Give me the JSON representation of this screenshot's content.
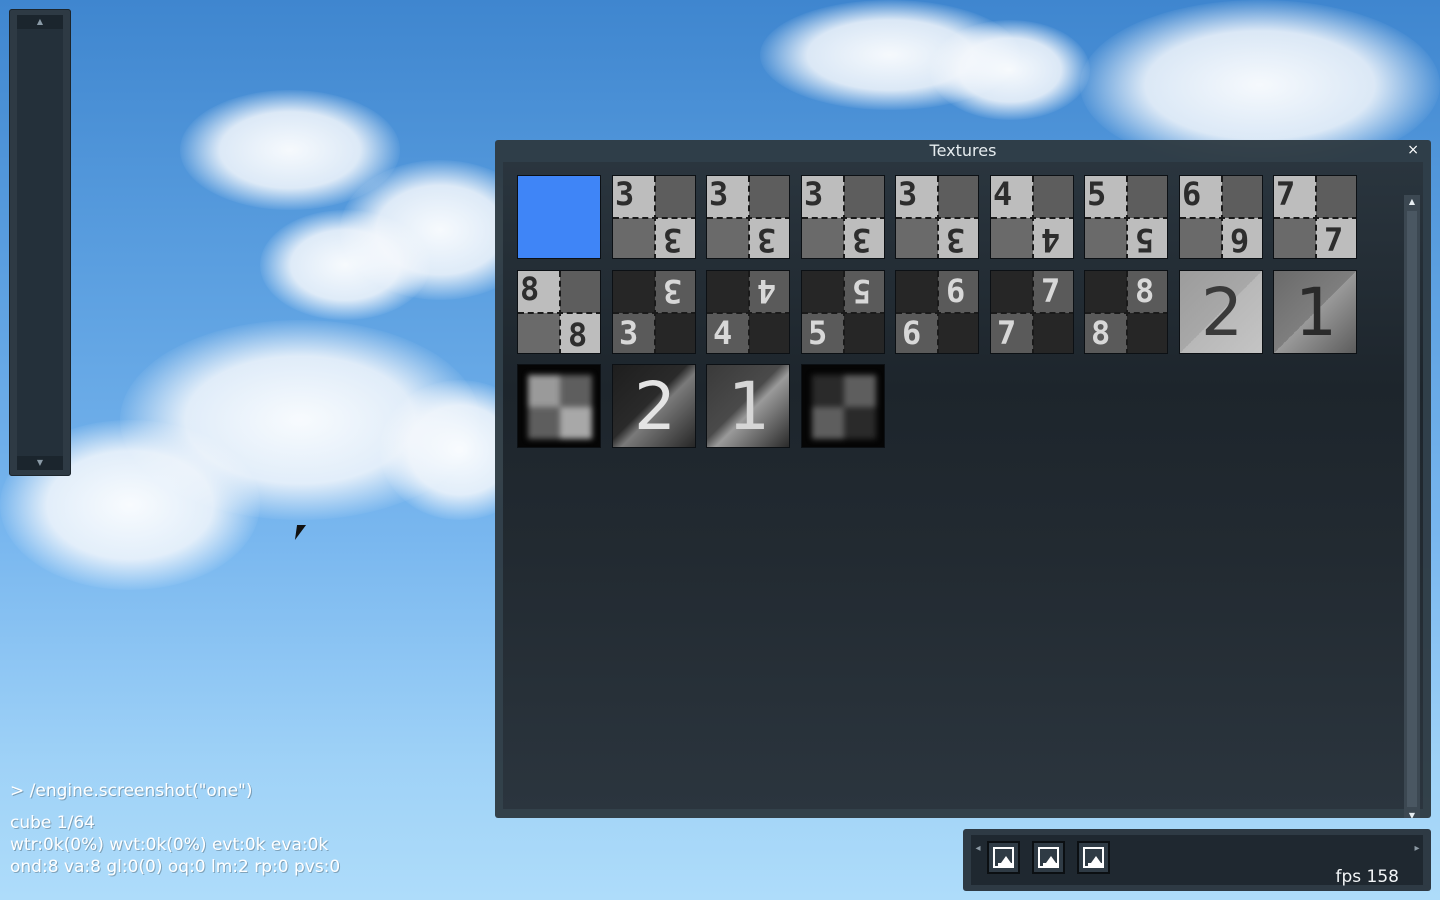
{
  "window": {
    "title": "Textures",
    "close_label": "×"
  },
  "textures": [
    {
      "kind": "solid",
      "color": "#3f85f7"
    },
    {
      "kind": "checker",
      "scheme": "light",
      "tl": "3",
      "br": "3",
      "br_mirrored": true
    },
    {
      "kind": "checker",
      "scheme": "light",
      "tl": "3",
      "br": "3",
      "br_mirrored": true
    },
    {
      "kind": "checker",
      "scheme": "light",
      "tl": "3",
      "br": "3",
      "br_mirrored": true
    },
    {
      "kind": "checker",
      "scheme": "light",
      "tl": "3",
      "br": "3",
      "br_mirrored": true
    },
    {
      "kind": "checker",
      "scheme": "light",
      "tl": "4",
      "br": "4",
      "br_mirrored": true
    },
    {
      "kind": "checker",
      "scheme": "light",
      "tl": "5",
      "br": "5",
      "br_mirrored": true
    },
    {
      "kind": "checker",
      "scheme": "light",
      "tl": "6",
      "br": "6",
      "br_mirrored": true
    },
    {
      "kind": "checker",
      "scheme": "light",
      "tl": "7",
      "br": "7",
      "br_mirrored": false
    },
    {
      "kind": "checker",
      "scheme": "light",
      "tl": "8",
      "br": "8",
      "br_mirrored": false
    },
    {
      "kind": "checker",
      "scheme": "dark",
      "tr": "3",
      "bl": "3",
      "tr_mirrored": true
    },
    {
      "kind": "checker",
      "scheme": "dark",
      "tr": "4",
      "bl": "4",
      "tr_mirrored": true
    },
    {
      "kind": "checker",
      "scheme": "dark",
      "tr": "5",
      "bl": "5",
      "tr_mirrored": true
    },
    {
      "kind": "checker",
      "scheme": "dark",
      "tr": "6",
      "bl": "6",
      "tr_mirrored": false
    },
    {
      "kind": "checker",
      "scheme": "dark",
      "tr": "7",
      "bl": "7",
      "tr_mirrored": false
    },
    {
      "kind": "checker",
      "scheme": "dark",
      "tr": "8",
      "bl": "8",
      "tr_mirrored": false
    },
    {
      "kind": "big",
      "label": "2",
      "scheme": "grey"
    },
    {
      "kind": "big",
      "label": "1",
      "scheme": "grey-dark"
    },
    {
      "kind": "blur",
      "scheme": "light"
    },
    {
      "kind": "big",
      "label": "2",
      "scheme": "mixed"
    },
    {
      "kind": "big",
      "label": "1",
      "scheme": "mixed-dark"
    },
    {
      "kind": "blur",
      "scheme": "dark"
    }
  ],
  "console": {
    "command": "> /engine.screenshot(\"one\")",
    "line1": "cube 1/64",
    "line2": "wtr:0k(0%) wvt:0k(0%) evt:0k eva:0k",
    "line3": "ond:8 va:8 gl:0(0) oq:0 lm:2 rp:0 pvs:0"
  },
  "toolbar": {
    "buttons": [
      "editor-mode-icon",
      "editor-mode-icon",
      "editor-mode-icon"
    ],
    "fps": "fps 158"
  }
}
